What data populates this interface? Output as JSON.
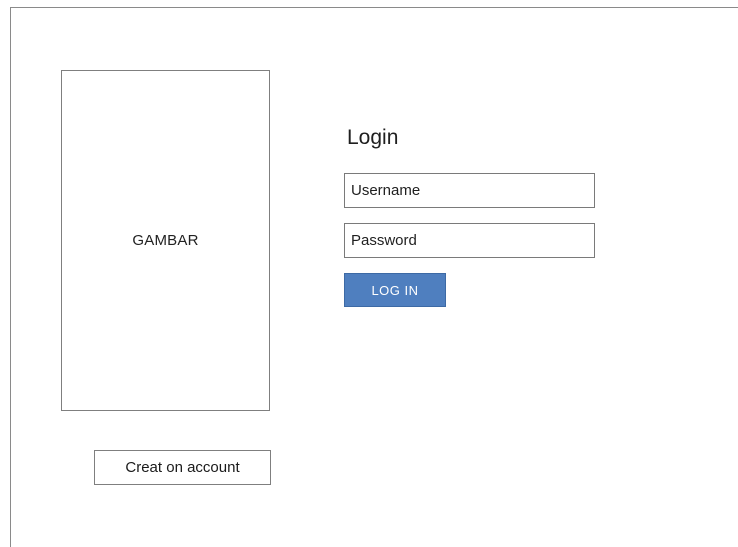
{
  "image_placeholder": {
    "label": "GAMBAR"
  },
  "create_account": {
    "label": "Creat on account"
  },
  "login": {
    "title": "Login",
    "username": {
      "placeholder": "Username",
      "value": ""
    },
    "password": {
      "placeholder": "Password",
      "value": ""
    },
    "button_label": "LOG IN"
  },
  "colors": {
    "button_background": "#4f7fbf",
    "button_text": "#ffffff",
    "border": "#7f7f7f"
  }
}
